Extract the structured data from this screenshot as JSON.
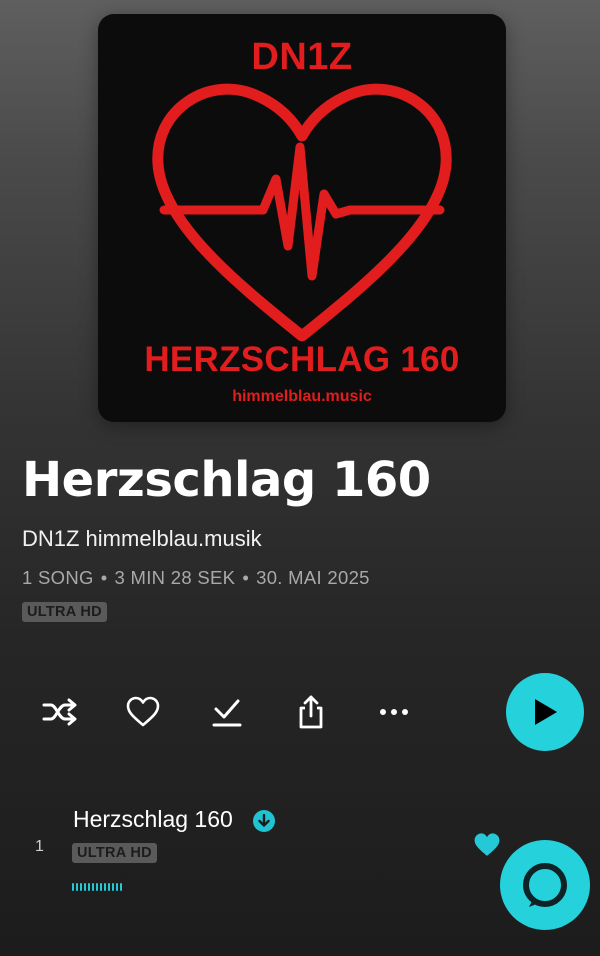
{
  "album": {
    "cover": {
      "top_text": "DN1Z",
      "main_text": "HERZSCHLAG 160",
      "url_text": "himmelblau.music",
      "accent_color": "#e11d1d"
    },
    "title": "Herzschlag 160",
    "artist": "DN1Z himmelblau.musik",
    "meta": {
      "songs": "1 SONG",
      "duration": "3 MIN 28 SEK",
      "date": "30. MAI 2025",
      "separator": "•"
    },
    "quality_badge": "ULTRA HD"
  },
  "controls": {
    "shuffle_icon": "shuffle-icon",
    "favorite_icon": "heart-outline-icon",
    "download_icon": "download-icon",
    "share_icon": "share-icon",
    "more_icon": "more-icon",
    "play_icon": "play-icon",
    "accent_color": "#25d1da"
  },
  "tracks": [
    {
      "number": "1",
      "title": "Herzschlag 160",
      "quality_badge": "ULTRA HD",
      "downloaded": true
    }
  ],
  "alexa_icon": "alexa-icon"
}
